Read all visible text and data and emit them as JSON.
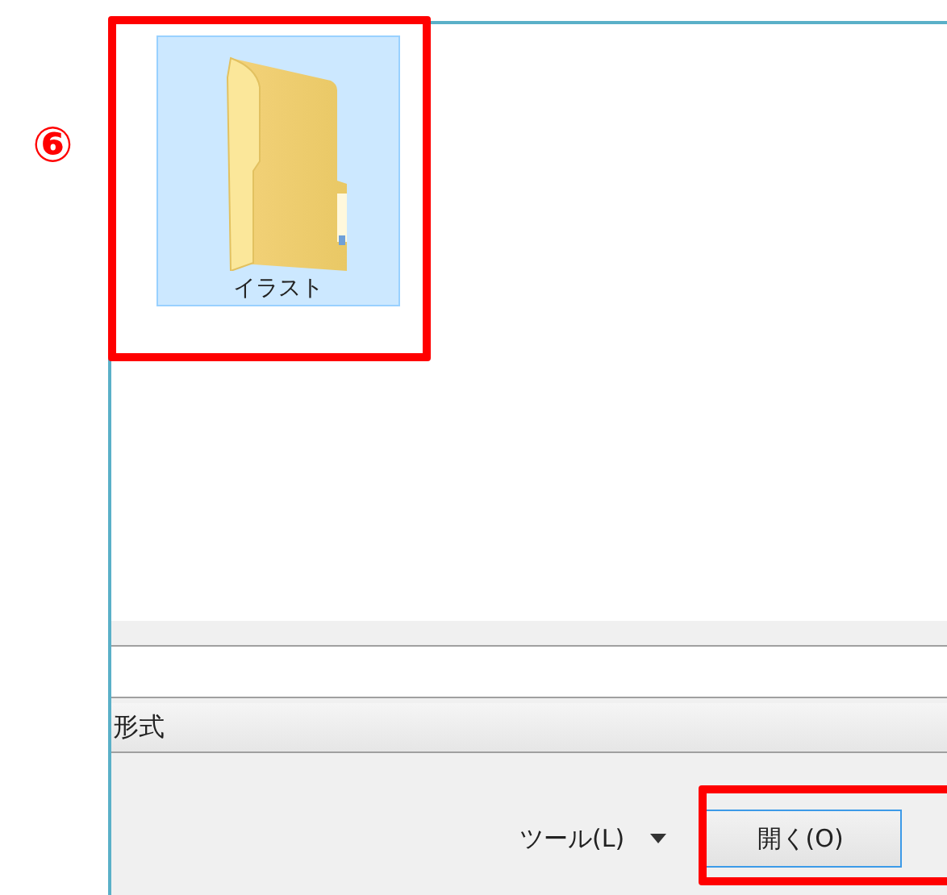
{
  "annotation": {
    "marker": "⑥"
  },
  "files": [
    {
      "name": "イラスト",
      "selected": true
    }
  ],
  "format_column": {
    "label": "形式"
  },
  "footer": {
    "tools": "ツール(L)",
    "open_button": "開く(O)"
  }
}
